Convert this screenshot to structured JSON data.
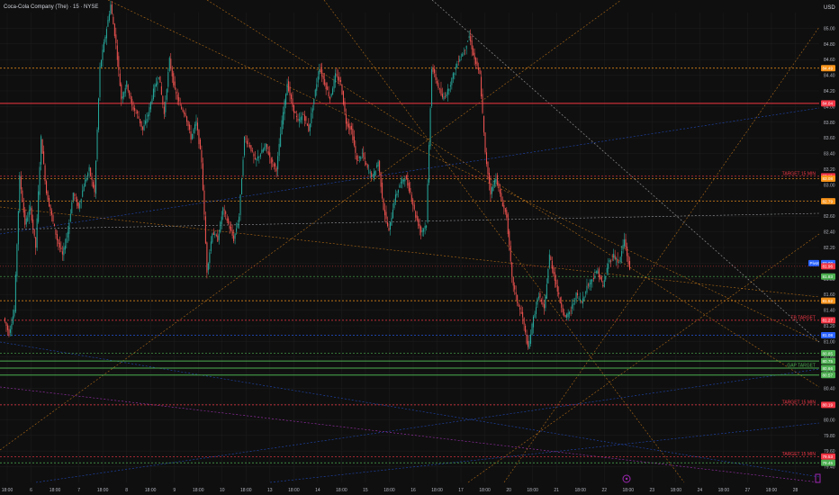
{
  "chart_data": {
    "type": "candlestick",
    "title": "Coca-Cola Company (The) · 15 · NYSE",
    "currency": "USD",
    "ylim": [
      79.2,
      85.2
    ],
    "y_ticks": [
      85.0,
      84.8,
      84.6,
      84.4,
      84.2,
      84.0,
      83.8,
      83.6,
      83.4,
      83.2,
      83.0,
      82.8,
      82.6,
      82.4,
      82.2,
      82.0,
      81.8,
      81.6,
      81.4,
      81.2,
      81.0,
      80.8,
      80.6,
      80.4,
      80.2,
      80.0,
      79.8,
      79.6,
      79.4
    ],
    "x_ticks": [
      "18:00",
      "6",
      "18:00",
      "7",
      "18:00",
      "8",
      "18:00",
      "9",
      "18:00",
      "10",
      "18:00",
      "13",
      "18:00",
      "14",
      "18:00",
      "15",
      "18:00",
      "16",
      "18:00",
      "17",
      "18:00",
      "20",
      "18:00",
      "21",
      "18:00",
      "22",
      "18:00",
      "23",
      "18:00",
      "24",
      "18:00",
      "27",
      "18:00",
      "28"
    ],
    "colors": {
      "up": "#26a69a",
      "down": "#ef5350",
      "grid": "#1e1e1e",
      "text": "#b2b5be",
      "background": "#0f0f0f"
    },
    "path": [
      81.3,
      81.1,
      81.4,
      83.1,
      82.5,
      82.7,
      82.2,
      83.6,
      82.9,
      82.6,
      82.3,
      82.1,
      82.4,
      82.9,
      82.7,
      83.0,
      83.2,
      82.9,
      84.5,
      84.9,
      85.3,
      84.8,
      84.1,
      84.3,
      84.0,
      83.9,
      83.7,
      83.9,
      84.2,
      84.4,
      83.9,
      84.6,
      84.2,
      84.0,
      83.9,
      83.6,
      83.8,
      83.3,
      81.9,
      82.4,
      82.3,
      82.7,
      82.5,
      82.3,
      82.6,
      83.6,
      83.5,
      83.3,
      83.4,
      83.5,
      83.3,
      83.2,
      83.8,
      84.3,
      84.0,
      83.8,
      83.9,
      83.7,
      84.1,
      84.5,
      84.3,
      84.1,
      84.4,
      84.3,
      83.8,
      83.7,
      83.3,
      83.4,
      83.2,
      83.1,
      83.3,
      82.7,
      82.4,
      82.8,
      83.0,
      83.1,
      82.9,
      82.6,
      82.4,
      82.5,
      84.5,
      84.3,
      84.1,
      84.2,
      84.4,
      84.6,
      84.7,
      84.9,
      84.6,
      84.4,
      83.4,
      82.9,
      83.1,
      82.8,
      82.6,
      81.8,
      81.5,
      81.3,
      80.9,
      81.3,
      81.6,
      81.4,
      82.1,
      81.8,
      81.5,
      81.3,
      81.4,
      81.6,
      81.5,
      81.7,
      81.8,
      81.9,
      81.7,
      82.0,
      82.1,
      82.0,
      82.3,
      81.9
    ],
    "levels": [
      {
        "price": 84.49,
        "color": "#f7931a",
        "tag": "84.49",
        "label": "",
        "style": "dashed"
      },
      {
        "price": 84.04,
        "color": "#f23645",
        "tag": "84.04",
        "label": "",
        "style": "solid"
      },
      {
        "price": 83.11,
        "color": "#f23645",
        "tag": "83.11",
        "label": "TARGET 15 MIN",
        "style": "dashed"
      },
      {
        "price": 83.08,
        "color": "#f7931a",
        "tag": "83.08",
        "label": "",
        "style": "dashed"
      },
      {
        "price": 82.79,
        "color": "#f7931a",
        "tag": "82.79",
        "label": "",
        "style": "dashed"
      },
      {
        "price": 81.83,
        "color": "#4caf50",
        "tag": "81.83",
        "label": "",
        "style": "dashed"
      },
      {
        "price": 81.52,
        "color": "#f7931a",
        "tag": "81.52",
        "label": "",
        "style": "dashed"
      },
      {
        "price": 81.27,
        "color": "#f23645",
        "tag": "81.27",
        "label": "TB TARGET",
        "style": "dashed"
      },
      {
        "price": 81.08,
        "color": "#2962ff",
        "tag": "81.08",
        "label": "",
        "style": "dashed"
      },
      {
        "price": 80.85,
        "color": "#4caf50",
        "tag": "80.85",
        "label": "",
        "style": "dashed"
      },
      {
        "price": 80.75,
        "color": "#4caf50",
        "tag": "80.75",
        "label": "",
        "style": "solid"
      },
      {
        "price": 80.66,
        "color": "#4caf50",
        "tag": "80.66",
        "label": "GAP TARGET",
        "style": "solid"
      },
      {
        "price": 80.57,
        "color": "#4caf50",
        "tag": "80.57",
        "label": "",
        "style": "solid"
      },
      {
        "price": 80.19,
        "color": "#f23645",
        "tag": "80.19",
        "label": "TARGET 15 MIN",
        "style": "dashed"
      },
      {
        "price": 79.53,
        "color": "#f23645",
        "tag": "79.53",
        "label": "TARGET 15 MIN",
        "style": "dashed"
      },
      {
        "price": 79.45,
        "color": "#4caf50",
        "tag": "79.45",
        "label": "",
        "style": "dashed"
      }
    ],
    "last_price": {
      "price": 81.96,
      "tag": "81.96",
      "color": "#f23645"
    },
    "pivot": {
      "price": 82.0,
      "tag": "82.00",
      "label": "Pivot",
      "color": "#2962ff"
    }
  }
}
